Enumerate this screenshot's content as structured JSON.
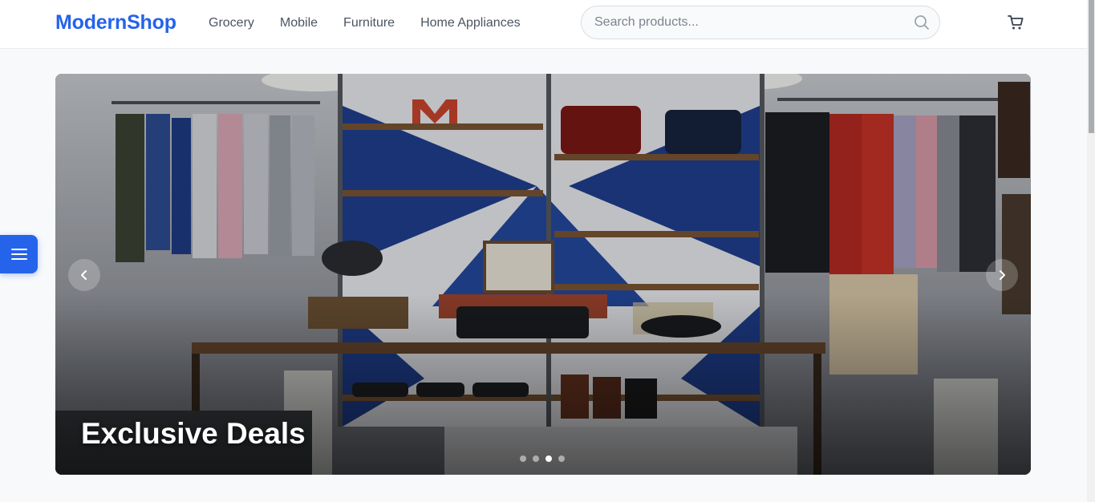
{
  "header": {
    "logo": "ModernShop",
    "nav": [
      "Grocery",
      "Mobile",
      "Furniture",
      "Home Appliances"
    ],
    "search_placeholder": "Search products..."
  },
  "hero": {
    "title": "Exclusive Deals",
    "slide_count": 4,
    "active_slide": 3
  },
  "icons": {
    "search": "search-icon",
    "cart": "cart-icon",
    "prev": "chevron-left-icon",
    "next": "chevron-right-icon",
    "menu": "hamburger-menu-icon"
  },
  "colors": {
    "brand": "#2563eb",
    "background": "#f8f9fb"
  }
}
